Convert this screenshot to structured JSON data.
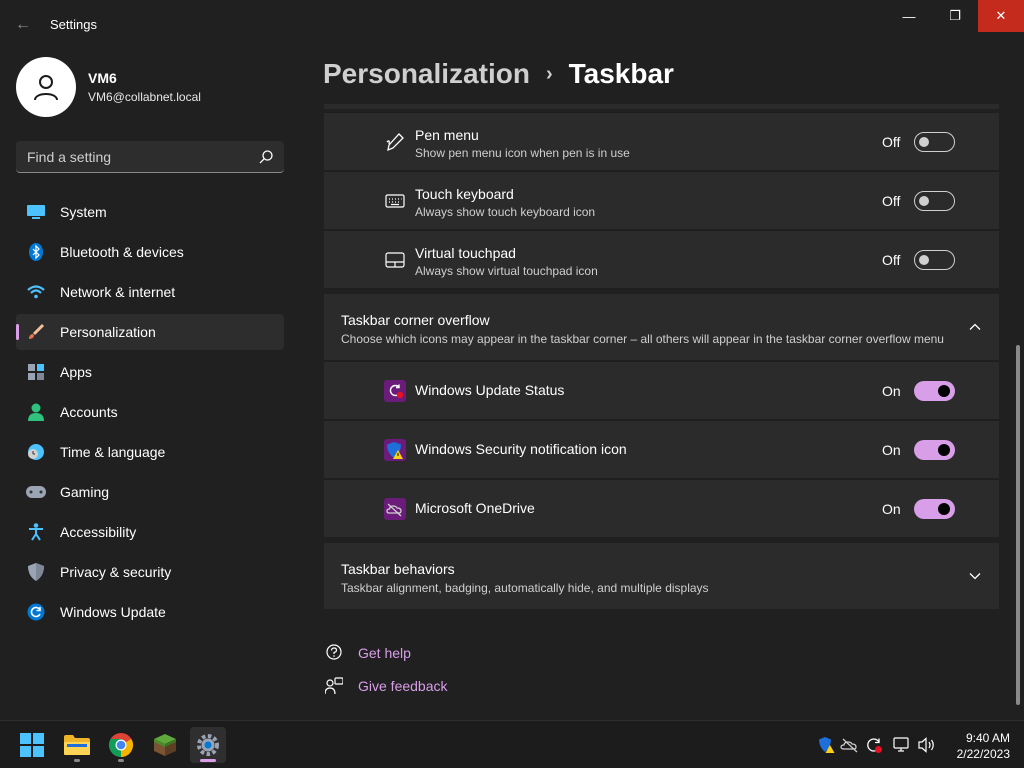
{
  "window": {
    "title": "Settings",
    "back_label": "←",
    "minimize_label": "—",
    "maximize_label": "❐",
    "close_label": "✕"
  },
  "profile": {
    "name": "VM6",
    "email": "VM6@collabnet.local"
  },
  "search": {
    "placeholder": "Find a setting"
  },
  "nav": {
    "items": [
      {
        "label": "System",
        "icon": "monitor-icon"
      },
      {
        "label": "Bluetooth & devices",
        "icon": "bluetooth-icon"
      },
      {
        "label": "Network & internet",
        "icon": "wifi-icon"
      },
      {
        "label": "Personalization",
        "icon": "brush-icon",
        "active": true
      },
      {
        "label": "Apps",
        "icon": "apps-icon"
      },
      {
        "label": "Accounts",
        "icon": "person-icon"
      },
      {
        "label": "Time & language",
        "icon": "clock-globe-icon"
      },
      {
        "label": "Gaming",
        "icon": "gamepad-icon"
      },
      {
        "label": "Accessibility",
        "icon": "accessibility-icon"
      },
      {
        "label": "Privacy & security",
        "icon": "shield-icon"
      },
      {
        "label": "Windows Update",
        "icon": "refresh-icon"
      }
    ]
  },
  "breadcrumb": {
    "parent": "Personalization",
    "separator": "›",
    "current": "Taskbar"
  },
  "corner_icons": [
    {
      "title": "Pen menu",
      "subtitle": "Show pen menu icon when pen is in use",
      "state": "Off",
      "icon": "pen-icon"
    },
    {
      "title": "Touch keyboard",
      "subtitle": "Always show touch keyboard icon",
      "state": "Off",
      "icon": "keyboard-icon"
    },
    {
      "title": "Virtual touchpad",
      "subtitle": "Always show virtual touchpad icon",
      "state": "Off",
      "icon": "touchpad-icon"
    }
  ],
  "overflow_section": {
    "title": "Taskbar corner overflow",
    "subtitle": "Choose which icons may appear in the taskbar corner – all others will appear in the taskbar corner overflow menu",
    "expanded": true,
    "items": [
      {
        "title": "Windows Update Status",
        "state": "On",
        "icon": "windows-update-status-icon"
      },
      {
        "title": "Windows Security notification icon",
        "state": "On",
        "icon": "windows-security-icon"
      },
      {
        "title": "Microsoft OneDrive",
        "state": "On",
        "icon": "onedrive-icon"
      }
    ]
  },
  "behaviors_section": {
    "title": "Taskbar behaviors",
    "subtitle": "Taskbar alignment, badging, automatically hide, and multiple displays",
    "expanded": false
  },
  "help": {
    "get_help": "Get help",
    "give_feedback": "Give feedback"
  },
  "taskbar": {
    "apps": [
      {
        "name": "start-button",
        "icon": "windows-logo-icon"
      },
      {
        "name": "file-explorer",
        "icon": "folder-icon"
      },
      {
        "name": "chrome",
        "icon": "chrome-icon"
      },
      {
        "name": "minecraft",
        "icon": "grass-block-icon"
      },
      {
        "name": "settings",
        "icon": "gear-icon",
        "active": true
      }
    ],
    "tray_icons": [
      "windows-security-tray-icon",
      "onedrive-tray-icon",
      "update-tray-icon",
      "network-icon",
      "volume-icon"
    ],
    "time": "9:40 AM",
    "date": "2/22/2023"
  },
  "colors": {
    "accent": "#d89ee8",
    "background": "#202020",
    "card": "#2b2b2b",
    "close_button": "#c42b1c"
  }
}
